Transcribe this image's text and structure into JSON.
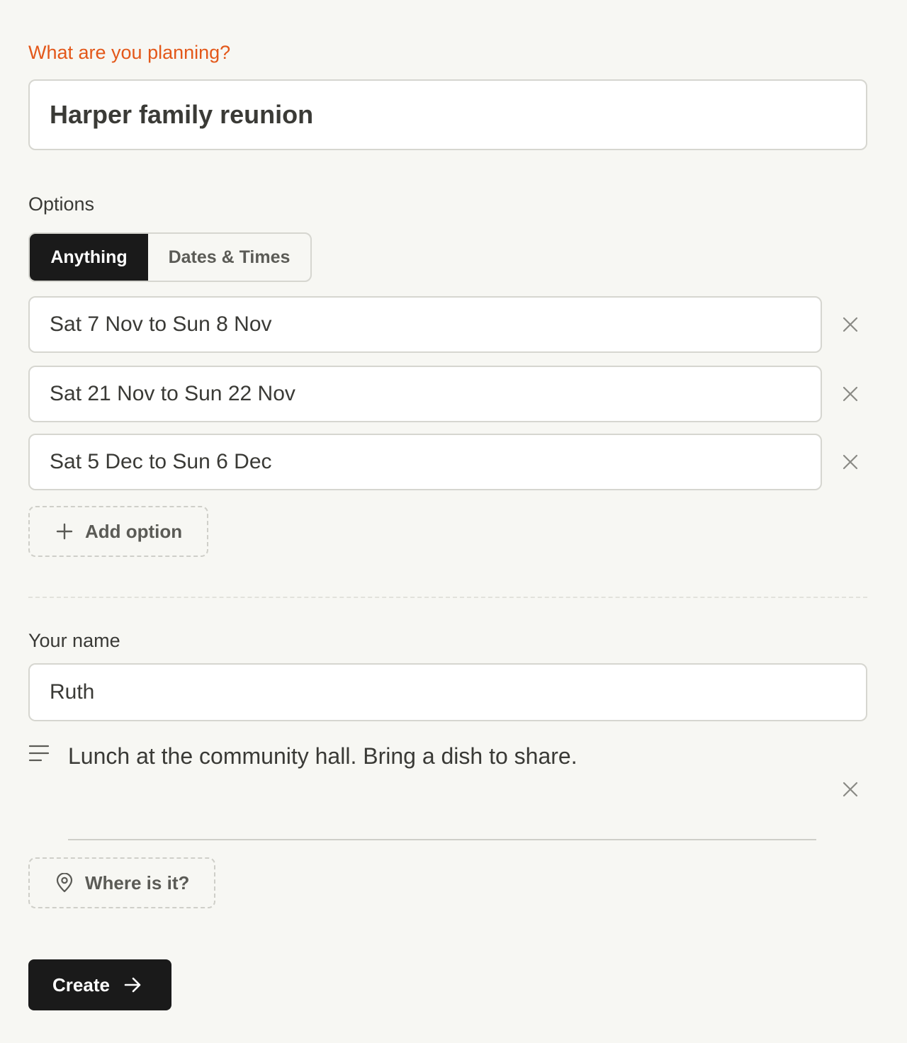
{
  "form": {
    "question_label": "What are you planning?",
    "title_value": "Harper family reunion",
    "options_label": "Options",
    "option_type_tabs": [
      {
        "label": "Anything",
        "active": true
      },
      {
        "label": "Dates & Times",
        "active": false
      }
    ],
    "options": [
      {
        "value": "Sat 7 Nov to Sun 8 Nov"
      },
      {
        "value": "Sat 21 Nov to Sun 22 Nov"
      },
      {
        "value": "Sat 5 Dec to Sun 6 Dec"
      }
    ],
    "add_option_label": "Add option",
    "name_label": "Your name",
    "name_value": "Ruth",
    "description_value": "Lunch at the community hall. Bring a dish to share.",
    "location_button_label": "Where is it?",
    "create_label": "Create"
  },
  "icons": {
    "remove": "close-icon",
    "add": "plus-icon",
    "description": "text-align-left-icon",
    "location": "map-pin-icon",
    "submit": "arrow-right-icon"
  },
  "colors": {
    "accent": "#e3581a",
    "primary_dark": "#1a1a1a",
    "background": "#f7f7f3"
  }
}
